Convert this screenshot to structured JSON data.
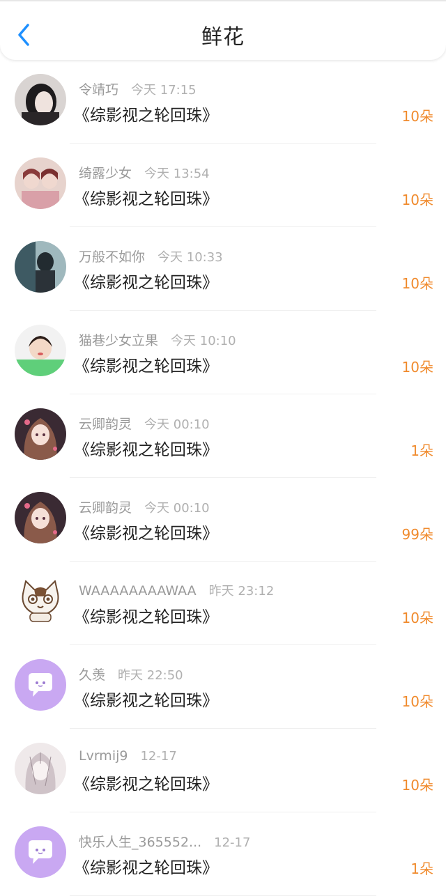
{
  "header": {
    "title": "鲜花"
  },
  "colors": {
    "accent": "#f08a2c",
    "back": "#1e90ff",
    "chat_avatar": "#c9a8f2"
  },
  "items": [
    {
      "user": "令靖巧",
      "time": "今天 17:15",
      "book": "《综影视之轮回珠》",
      "count": "10朵",
      "avatar": "photo-dark"
    },
    {
      "user": "绮露少女",
      "time": "今天 13:54",
      "book": "《综影视之轮回珠》",
      "count": "10朵",
      "avatar": "photo-pink"
    },
    {
      "user": "万般不如你",
      "time": "今天 10:33",
      "book": "《综影视之轮回珠》",
      "count": "10朵",
      "avatar": "photo-teal"
    },
    {
      "user": "猫巷少女立果",
      "time": "今天 10:10",
      "book": "《综影视之轮回珠》",
      "count": "10朵",
      "avatar": "photo-child"
    },
    {
      "user": "云卿韵灵",
      "time": "今天 00:10",
      "book": "《综影视之轮回珠》",
      "count": "1朵",
      "avatar": "anime-girl"
    },
    {
      "user": "云卿韵灵",
      "time": "今天 00:10",
      "book": "《综影视之轮回珠》",
      "count": "99朵",
      "avatar": "anime-girl"
    },
    {
      "user": "WAAAAAAAAWAA",
      "time": "昨天 23:12",
      "book": "《综影视之轮回珠》",
      "count": "10朵",
      "avatar": "cat-cartoon"
    },
    {
      "user": "久羡",
      "time": "昨天 22:50",
      "book": "《综影视之轮回珠》",
      "count": "10朵",
      "avatar": "chat-bubble-icon"
    },
    {
      "user": "Lvrmij9",
      "time": "12-17",
      "book": "《综影视之轮回珠》",
      "count": "10朵",
      "avatar": "anime-sketch"
    },
    {
      "user": "快乐人生_365552...",
      "time": "12-17",
      "book": "《综影视之轮回珠》",
      "count": "1朵",
      "avatar": "chat-bubble-icon"
    }
  ]
}
